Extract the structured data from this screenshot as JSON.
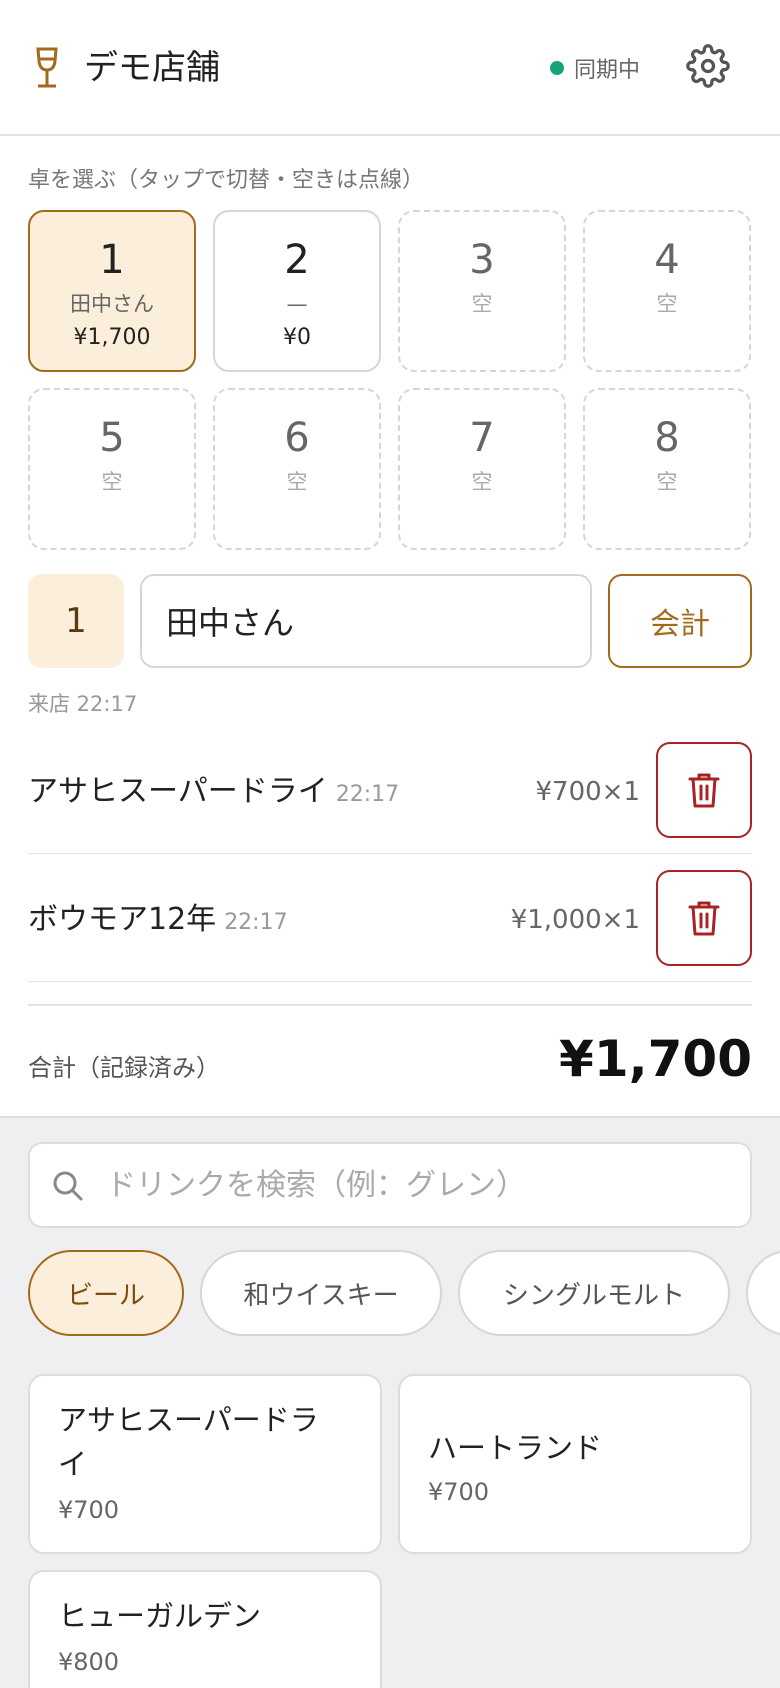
{
  "header": {
    "store_name": "デモ店舗",
    "sync_status": "同期中",
    "sync_color": "#1aa37a",
    "icons": {
      "logo": "wine-glass-icon",
      "settings": "gear-icon"
    }
  },
  "tables": {
    "label": "卓を選ぶ（タップで切替・空きは点線）",
    "items": [
      {
        "number": "1",
        "name": "田中さん",
        "total": "¥1,700",
        "state": "active"
      },
      {
        "number": "2",
        "name": "—",
        "total": "¥0",
        "state": "occupied"
      },
      {
        "number": "3",
        "name": "空",
        "total": "",
        "state": "empty"
      },
      {
        "number": "4",
        "name": "空",
        "total": "",
        "state": "empty"
      },
      {
        "number": "5",
        "name": "空",
        "total": "",
        "state": "empty"
      },
      {
        "number": "6",
        "name": "空",
        "total": "",
        "state": "empty"
      },
      {
        "number": "7",
        "name": "空",
        "total": "",
        "state": "empty"
      },
      {
        "number": "8",
        "name": "空",
        "total": "",
        "state": "empty"
      }
    ]
  },
  "selected": {
    "number": "1",
    "name_value": "田中さん",
    "checkout_label": "会計",
    "visit_time": "来店 22:17"
  },
  "orders": [
    {
      "name": "アサヒスーパードライ",
      "time": "22:17",
      "price": "¥700×1"
    },
    {
      "name": "ボウモア12年",
      "time": "22:17",
      "price": "¥1,000×1"
    }
  ],
  "total": {
    "label": "合計（記録済み）",
    "amount": "¥1,700"
  },
  "search": {
    "placeholder": "ドリンクを検索（例：グレン）",
    "value": ""
  },
  "categories": [
    {
      "label": "ビール",
      "active": true
    },
    {
      "label": "和ウイスキー",
      "active": false
    },
    {
      "label": "シングルモルト",
      "active": false
    },
    {
      "label": "",
      "active": false
    }
  ],
  "drinks": [
    {
      "name_line1": "アサヒスーパードラ",
      "name_line2": "イ",
      "price": "¥700"
    },
    {
      "name_line1": "ハートランド",
      "price": "¥700"
    },
    {
      "name_line1": "ヒューガルデン",
      "price": "¥800"
    }
  ],
  "colors": {
    "accent": "#a36a1c",
    "accent_bg": "#fbeedb",
    "danger": "#a82424"
  }
}
